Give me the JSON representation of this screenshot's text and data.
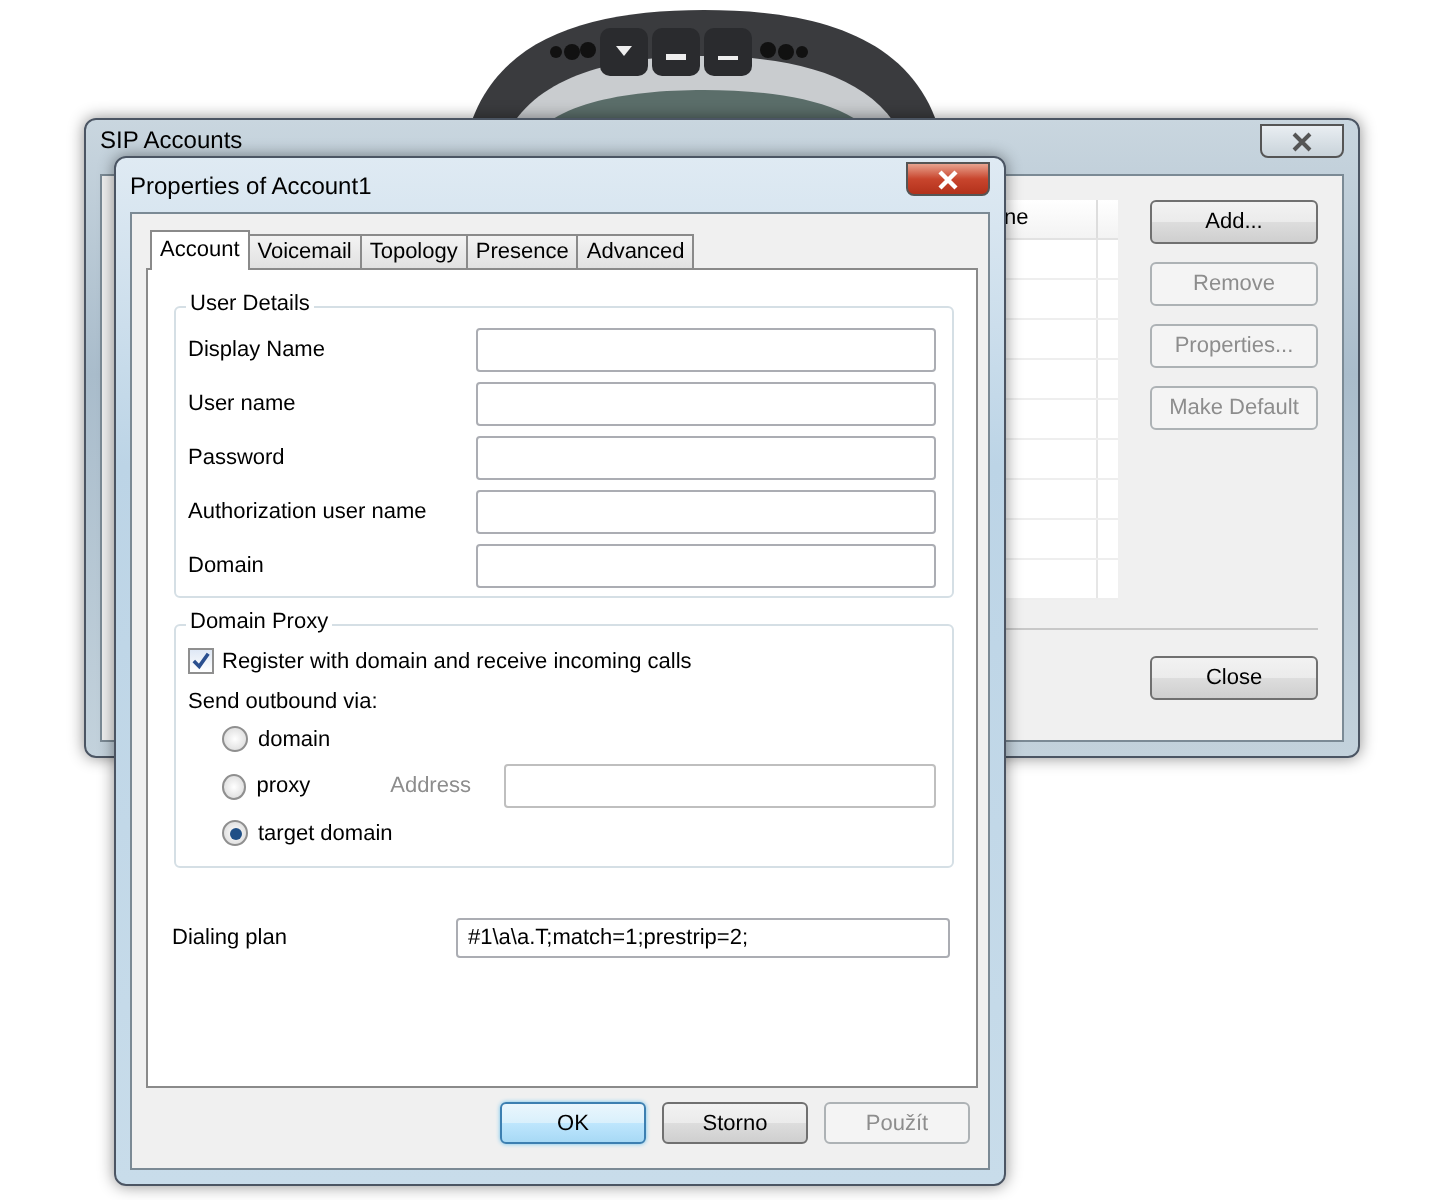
{
  "gadget": {
    "kind": "phone"
  },
  "accounts_window": {
    "title": "SIP Accounts",
    "table": {
      "columns": [
        "ne"
      ]
    },
    "buttons": [
      {
        "label": "Add...",
        "disabled": false
      },
      {
        "label": "Remove",
        "disabled": true
      },
      {
        "label": "Properties...",
        "disabled": true
      },
      {
        "label": "Make Default",
        "disabled": true
      }
    ],
    "close_button": {
      "label": "Close"
    }
  },
  "dialog": {
    "title": "Properties of Account1",
    "tabs": [
      {
        "label": "Account",
        "selected": true
      },
      {
        "label": "Voicemail",
        "selected": false
      },
      {
        "label": "Topology",
        "selected": false
      },
      {
        "label": "Presence",
        "selected": false
      },
      {
        "label": "Advanced",
        "selected": false
      }
    ],
    "user_details": {
      "title": "User Details",
      "fields": [
        {
          "label": "Display Name"
        },
        {
          "label": "User name"
        },
        {
          "label": "Password"
        },
        {
          "label": "Authorization user name"
        },
        {
          "label": "Domain"
        }
      ]
    },
    "domain_proxy": {
      "title": "Domain Proxy",
      "register": {
        "label": "Register with domain and receive incoming calls",
        "checked": true
      },
      "send_label": "Send outbound via:",
      "options": [
        {
          "label": "domain",
          "selected": false
        },
        {
          "label": "proxy",
          "selected": false
        },
        {
          "label": "target domain",
          "selected": true
        }
      ],
      "address": {
        "label": "Address",
        "disabled": true
      }
    },
    "dialing_plan": {
      "label": "Dialing plan",
      "value": "#1\\a\\a.T;match=1;prestrip=2;"
    },
    "buttons": [
      {
        "label": "OK",
        "default": true,
        "disabled": false
      },
      {
        "label": "Storno",
        "default": false,
        "disabled": false
      },
      {
        "label": "Použít",
        "default": false,
        "disabled": true
      }
    ]
  }
}
